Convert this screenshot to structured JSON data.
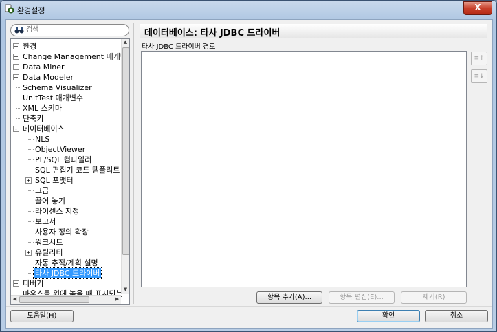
{
  "window": {
    "title": "환경설정",
    "close_label": "X"
  },
  "search": {
    "placeholder": "검색",
    "icon": "binoculars-icon"
  },
  "tree": {
    "items": [
      {
        "label": "환경",
        "level": 0,
        "expander": "+"
      },
      {
        "label": "Change Management 매개변수",
        "level": 0,
        "expander": "+"
      },
      {
        "label": "Data Miner",
        "level": 0,
        "expander": "+"
      },
      {
        "label": "Data Modeler",
        "level": 0,
        "expander": "+"
      },
      {
        "label": "Schema Visualizer",
        "level": 0,
        "expander": ""
      },
      {
        "label": "UnitTest 매개변수",
        "level": 0,
        "expander": ""
      },
      {
        "label": "XML 스키마",
        "level": 0,
        "expander": ""
      },
      {
        "label": "단축키",
        "level": 0,
        "expander": ""
      },
      {
        "label": "데이터베이스",
        "level": 0,
        "expander": "-"
      },
      {
        "label": "NLS",
        "level": 1,
        "expander": ""
      },
      {
        "label": "ObjectViewer",
        "level": 1,
        "expander": ""
      },
      {
        "label": "PL/SQL 컴파일러",
        "level": 1,
        "expander": ""
      },
      {
        "label": "SQL 편집기 코드 템플리트",
        "level": 1,
        "expander": ""
      },
      {
        "label": "SQL 포맷터",
        "level": 1,
        "expander": "+"
      },
      {
        "label": "고급",
        "level": 1,
        "expander": ""
      },
      {
        "label": "끌어 놓기",
        "level": 1,
        "expander": ""
      },
      {
        "label": "라이센스 지정",
        "level": 1,
        "expander": ""
      },
      {
        "label": "보고서",
        "level": 1,
        "expander": ""
      },
      {
        "label": "사용자 정의 확장",
        "level": 1,
        "expander": ""
      },
      {
        "label": "워크시트",
        "level": 1,
        "expander": ""
      },
      {
        "label": "유틸리티",
        "level": 1,
        "expander": "+"
      },
      {
        "label": "자동 추적/계획 설명",
        "level": 1,
        "expander": ""
      },
      {
        "label": "타사 JDBC 드라이버",
        "level": 1,
        "expander": "",
        "selected": true
      },
      {
        "label": "디버거",
        "level": 0,
        "expander": "+"
      },
      {
        "label": "마우스를 위에 놓을 때 표시되는",
        "level": 0,
        "expander": ""
      }
    ]
  },
  "panel": {
    "title": "데이터베이스: 타사 JDBC 드라이버",
    "path_label": "타사 JDBC 드라이버 경로",
    "move_up_label": "≡↑",
    "move_down_label": "≡↓",
    "add_button": "항목 추가(A)...",
    "edit_button": "항목 편집(E)...",
    "remove_button": "제거(R)"
  },
  "footer": {
    "help_button": "도움말(H)",
    "ok_button": "확인",
    "cancel_button": "취소"
  },
  "colors": {
    "selection": "#3399ff",
    "title_close": "#c8402b"
  }
}
